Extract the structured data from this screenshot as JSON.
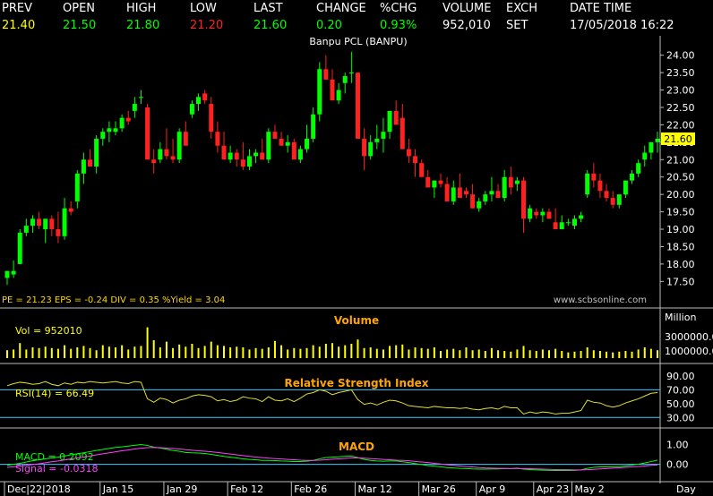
{
  "quote": {
    "headers": [
      "PREV",
      "OPEN",
      "HIGH",
      "LOW",
      "LAST",
      "CHANGE",
      "%CHG",
      "VOLUME",
      "EXCH",
      "DATE TIME"
    ],
    "values": [
      "21.40",
      "21.50",
      "21.80",
      "21.20",
      "21.60",
      "0.20",
      "0.93%",
      "952,010",
      "SET",
      "17/05/2018 16:22"
    ],
    "value_colors": [
      "#ffff00",
      "#00ff00",
      "#00ff00",
      "#ff2020",
      "#00ff00",
      "#00ff00",
      "#00ff00",
      "#ffffff",
      "#ffffff",
      "#ffffff"
    ]
  },
  "chart_data": [
    {
      "type": "candlestick",
      "title": "Banpu PCL (BANPU)",
      "fundamentals": "PE = 21.23   EPS = -0.24   DIV = 0.35   %Yield = 3.04",
      "watermark": "www.scbsonline.com",
      "last_label": "21.60",
      "ylim": [
        17.2,
        24.3
      ],
      "y_ticks": [
        "24.00",
        "23.50",
        "23.00",
        "22.50",
        "22.00",
        "21.50",
        "21.00",
        "20.50",
        "20.00",
        "19.50",
        "19.00",
        "18.50",
        "18.00",
        "17.50"
      ],
      "x_ticks": [
        "Dec|22|2018",
        "Jan|15",
        "Jan|29",
        "Feb|12",
        "Feb|26",
        "Mar|12",
        "Mar|26",
        "Apr|9",
        "Apr|23",
        "May|2",
        "Day"
      ],
      "x_tick_index": [
        0,
        15,
        25,
        35,
        45,
        55,
        65,
        74,
        83,
        89
      ],
      "colors": {
        "up": "#00ff00",
        "down": "#ff2020"
      },
      "ohlc": [
        [
          17.6,
          17.8,
          17.4,
          17.8
        ],
        [
          17.7,
          18.1,
          17.6,
          17.8
        ],
        [
          18.0,
          19.0,
          18.0,
          18.9
        ],
        [
          18.9,
          19.3,
          18.8,
          19.1
        ],
        [
          19.1,
          19.4,
          18.9,
          19.3
        ],
        [
          19.3,
          19.5,
          19.0,
          19.1
        ],
        [
          19.0,
          19.3,
          18.6,
          19.3
        ],
        [
          19.3,
          19.4,
          18.8,
          19.0
        ],
        [
          19.0,
          19.5,
          18.6,
          18.8
        ],
        [
          18.8,
          19.9,
          18.7,
          19.6
        ],
        [
          19.6,
          19.8,
          19.4,
          19.5
        ],
        [
          19.8,
          20.7,
          19.6,
          20.6
        ],
        [
          20.6,
          21.2,
          20.3,
          21.0
        ],
        [
          21.0,
          21.3,
          20.9,
          20.8
        ],
        [
          20.8,
          21.7,
          20.6,
          21.6
        ],
        [
          21.6,
          21.9,
          21.4,
          21.8
        ],
        [
          21.8,
          22.1,
          21.5,
          21.9
        ],
        [
          21.8,
          22.1,
          21.7,
          21.9
        ],
        [
          21.9,
          22.3,
          21.8,
          22.2
        ],
        [
          22.2,
          22.4,
          22.0,
          22.1
        ],
        [
          22.4,
          22.8,
          22.2,
          22.6
        ],
        [
          22.8,
          23.0,
          22.6,
          22.8
        ],
        [
          22.5,
          22.6,
          21.6,
          21.0
        ],
        [
          21.0,
          21.3,
          20.6,
          20.9
        ],
        [
          21.0,
          21.5,
          20.9,
          21.3
        ],
        [
          21.3,
          21.9,
          21.0,
          21.1
        ],
        [
          21.1,
          21.6,
          20.9,
          21.0
        ],
        [
          21.0,
          21.9,
          20.9,
          21.8
        ],
        [
          21.8,
          22.1,
          21.6,
          21.4
        ],
        [
          22.3,
          22.7,
          22.2,
          22.6
        ],
        [
          22.6,
          22.9,
          22.4,
          22.8
        ],
        [
          22.9,
          23.0,
          22.6,
          22.7
        ],
        [
          22.6,
          22.8,
          21.6,
          21.8
        ],
        [
          21.8,
          22.1,
          21.2,
          21.4
        ],
        [
          21.4,
          21.8,
          21.1,
          21.0
        ],
        [
          21.0,
          21.4,
          20.9,
          21.2
        ],
        [
          21.2,
          21.3,
          20.8,
          21.0
        ],
        [
          21.0,
          21.5,
          20.7,
          20.8
        ],
        [
          20.8,
          21.3,
          20.7,
          21.1
        ],
        [
          21.1,
          21.3,
          20.9,
          21.2
        ],
        [
          21.2,
          21.6,
          21.0,
          21.0
        ],
        [
          21.0,
          21.9,
          20.9,
          21.8
        ],
        [
          21.8,
          22.0,
          21.6,
          21.6
        ],
        [
          21.6,
          21.8,
          21.4,
          21.4
        ],
        [
          21.4,
          21.7,
          21.2,
          21.5
        ],
        [
          21.5,
          21.6,
          21.2,
          21.0
        ],
        [
          21.0,
          21.4,
          20.9,
          21.3
        ],
        [
          21.3,
          22.0,
          21.2,
          21.6
        ],
        [
          21.6,
          22.5,
          21.5,
          22.3
        ],
        [
          22.3,
          23.8,
          22.1,
          23.6
        ],
        [
          23.6,
          24.0,
          23.3,
          23.3
        ],
        [
          23.3,
          23.6,
          23.0,
          22.7
        ],
        [
          22.7,
          23.2,
          22.6,
          23.0
        ],
        [
          23.2,
          23.5,
          22.9,
          23.4
        ],
        [
          23.5,
          24.1,
          23.2,
          23.5
        ],
        [
          23.5,
          23.5,
          21.7,
          21.6
        ],
        [
          21.6,
          21.9,
          20.7,
          21.1
        ],
        [
          21.1,
          21.7,
          21.0,
          21.5
        ],
        [
          21.5,
          22.0,
          21.3,
          21.6
        ],
        [
          21.6,
          22.2,
          21.2,
          21.8
        ],
        [
          21.8,
          22.3,
          21.6,
          22.4
        ],
        [
          22.4,
          22.7,
          22.3,
          22.0
        ],
        [
          22.2,
          22.6,
          21.6,
          21.3
        ],
        [
          21.3,
          21.6,
          20.9,
          21.1
        ],
        [
          21.1,
          21.3,
          20.5,
          20.9
        ],
        [
          20.9,
          21.0,
          20.5,
          20.5
        ],
        [
          20.5,
          20.7,
          20.2,
          20.2
        ],
        [
          20.2,
          20.4,
          19.9,
          20.4
        ],
        [
          20.4,
          20.6,
          20.2,
          20.3
        ],
        [
          20.3,
          20.5,
          19.8,
          19.8
        ],
        [
          19.8,
          20.4,
          19.7,
          20.2
        ],
        [
          20.2,
          20.6,
          20.0,
          19.9
        ],
        [
          20.1,
          20.2,
          19.9,
          20.0
        ],
        [
          20.0,
          20.3,
          19.6,
          19.6
        ],
        [
          19.6,
          19.9,
          19.5,
          19.8
        ],
        [
          19.8,
          20.1,
          19.7,
          20.0
        ],
        [
          20.0,
          20.5,
          19.8,
          20.1
        ],
        [
          20.1,
          20.3,
          19.9,
          19.9
        ],
        [
          19.9,
          20.7,
          19.8,
          20.5
        ],
        [
          20.5,
          20.8,
          20.0,
          20.2
        ],
        [
          20.3,
          20.5,
          20.1,
          20.4
        ],
        [
          20.4,
          20.5,
          18.9,
          19.3
        ],
        [
          19.3,
          19.7,
          19.2,
          19.6
        ],
        [
          19.5,
          19.6,
          19.3,
          19.4
        ],
        [
          19.4,
          19.6,
          19.2,
          19.5
        ],
        [
          19.5,
          19.6,
          19.3,
          19.3
        ],
        [
          19.2,
          19.6,
          19.0,
          19.0
        ],
        [
          19.0,
          19.4,
          19.0,
          19.2
        ],
        [
          19.2,
          19.3,
          19.1,
          19.2
        ],
        [
          19.1,
          19.4,
          19.0,
          19.3
        ],
        [
          19.3,
          19.5,
          19.2,
          19.4
        ],
        [
          20.0,
          20.7,
          19.9,
          20.6
        ],
        [
          20.6,
          20.9,
          20.2,
          20.4
        ],
        [
          20.4,
          20.6,
          19.9,
          20.1
        ],
        [
          20.1,
          20.3,
          19.8,
          19.9
        ],
        [
          19.9,
          20.1,
          19.6,
          19.7
        ],
        [
          19.7,
          20.0,
          19.6,
          20.0
        ],
        [
          20.0,
          20.4,
          19.9,
          20.4
        ],
        [
          20.4,
          20.7,
          20.3,
          20.6
        ],
        [
          20.6,
          21.0,
          20.5,
          20.9
        ],
        [
          21.0,
          21.4,
          20.8,
          21.2
        ],
        [
          21.2,
          21.5,
          21.0,
          21.5
        ],
        [
          21.5,
          21.8,
          21.2,
          21.6
        ]
      ]
    },
    {
      "type": "bar",
      "title": "Volume",
      "label": "Vol  =  952010",
      "unit": "Million",
      "ylim": [
        0,
        6000000
      ],
      "y_ticks": [
        3000000,
        1000000
      ],
      "y_tick_labels": [
        "3000000.0",
        "1000000.0"
      ],
      "color": "#ffff00",
      "values": [
        1100000,
        1200000,
        2100000,
        1200000,
        1500000,
        1400000,
        1600000,
        1400000,
        1300000,
        1800000,
        1300000,
        1500000,
        1700000,
        1400000,
        1100000,
        1800000,
        1600000,
        1500000,
        1800000,
        1200000,
        1600000,
        1700000,
        4300000,
        2500000,
        1500000,
        2300000,
        1400000,
        1900000,
        1600000,
        2000000,
        1400000,
        1700000,
        2300000,
        1800000,
        1700000,
        1500000,
        1600000,
        1500000,
        1200000,
        1400000,
        1300000,
        1500000,
        2400000,
        1800000,
        1200000,
        1400000,
        1300000,
        1400000,
        1800000,
        1600000,
        2000000,
        2100000,
        1600000,
        1800000,
        2000000,
        2600000,
        1400000,
        1500000,
        1300000,
        1200000,
        1700000,
        1800000,
        1900000,
        1200000,
        1500000,
        1400000,
        1300000,
        1500000,
        1000000,
        1200000,
        1300000,
        1100000,
        1500000,
        1100000,
        1200000,
        1000000,
        1400000,
        1100000,
        1000000,
        900000,
        1200000,
        1700000,
        1100000,
        1000000,
        1200000,
        1100000,
        1300000,
        1000000,
        800000,
        900000,
        1000000,
        1500000,
        1100000,
        1000000,
        900000,
        800000,
        900000,
        1000000,
        900000,
        1200000,
        1500000,
        1300000,
        1100000
      ]
    },
    {
      "type": "line",
      "title": "Relative Strength Index",
      "label": "RSI(14)  =  66.49",
      "ylim": [
        20,
        90
      ],
      "y_ticks": [
        90,
        70,
        50,
        30
      ],
      "y_tick_labels": [
        "90.00",
        "70.00",
        "50.00",
        "30.00"
      ],
      "ref_lines": [
        70,
        30
      ],
      "color": "#e0e030",
      "values": [
        76,
        79,
        81,
        80,
        78,
        79,
        82,
        78,
        76,
        80,
        78,
        81,
        80,
        82,
        81,
        80,
        81,
        82,
        80,
        79,
        82,
        81,
        57,
        52,
        58,
        56,
        51,
        55,
        57,
        61,
        63,
        62,
        60,
        54,
        56,
        53,
        55,
        60,
        58,
        57,
        53,
        60,
        55,
        54,
        57,
        53,
        58,
        64,
        66,
        70,
        68,
        63,
        66,
        68,
        70,
        56,
        49,
        51,
        48,
        52,
        55,
        54,
        51,
        47,
        46,
        45,
        44,
        46,
        45,
        44,
        44,
        43,
        44,
        42,
        41,
        43,
        44,
        42,
        46,
        44,
        44,
        35,
        38,
        36,
        38,
        37,
        35,
        36,
        36,
        38,
        40,
        55,
        52,
        51,
        47,
        45,
        47,
        51,
        54,
        57,
        61,
        65,
        66
      ]
    },
    {
      "type": "line",
      "title": "MACD",
      "ylim": [
        -0.6,
        1.2
      ],
      "y_ticks": [
        1.0,
        0.0
      ],
      "y_tick_labels": [
        "1.00",
        "0.00"
      ],
      "series": [
        {
          "name": "MACD  =  0.2092",
          "color": "#00ff00",
          "values": [
            -0.05,
            0.0,
            0.05,
            0.12,
            0.18,
            0.23,
            0.28,
            0.33,
            0.36,
            0.42,
            0.48,
            0.53,
            0.58,
            0.64,
            0.7,
            0.75,
            0.8,
            0.85,
            0.88,
            0.92,
            0.96,
            1.0,
            0.95,
            0.87,
            0.82,
            0.76,
            0.7,
            0.66,
            0.6,
            0.58,
            0.57,
            0.55,
            0.5,
            0.45,
            0.4,
            0.36,
            0.32,
            0.28,
            0.25,
            0.23,
            0.2,
            0.2,
            0.19,
            0.17,
            0.16,
            0.14,
            0.14,
            0.16,
            0.2,
            0.28,
            0.34,
            0.36,
            0.38,
            0.4,
            0.42,
            0.34,
            0.25,
            0.2,
            0.17,
            0.16,
            0.17,
            0.17,
            0.13,
            0.09,
            0.04,
            -0.01,
            -0.06,
            -0.09,
            -0.12,
            -0.16,
            -0.18,
            -0.2,
            -0.21,
            -0.23,
            -0.24,
            -0.24,
            -0.23,
            -0.23,
            -0.21,
            -0.21,
            -0.19,
            -0.24,
            -0.26,
            -0.28,
            -0.29,
            -0.3,
            -0.31,
            -0.31,
            -0.31,
            -0.3,
            -0.28,
            -0.2,
            -0.15,
            -0.13,
            -0.13,
            -0.12,
            -0.11,
            -0.08,
            -0.04,
            0.01,
            0.07,
            0.14,
            0.21
          ]
        },
        {
          "name": "Signal  =  -0.0318",
          "color": "#ff40ff",
          "values": [
            -0.15,
            -0.12,
            -0.09,
            -0.05,
            -0.01,
            0.03,
            0.08,
            0.13,
            0.17,
            0.22,
            0.27,
            0.32,
            0.37,
            0.42,
            0.48,
            0.53,
            0.58,
            0.63,
            0.68,
            0.72,
            0.77,
            0.81,
            0.84,
            0.85,
            0.84,
            0.82,
            0.8,
            0.77,
            0.74,
            0.71,
            0.68,
            0.66,
            0.63,
            0.6,
            0.56,
            0.52,
            0.48,
            0.44,
            0.4,
            0.37,
            0.34,
            0.31,
            0.29,
            0.27,
            0.25,
            0.23,
            0.21,
            0.2,
            0.2,
            0.21,
            0.23,
            0.26,
            0.28,
            0.3,
            0.32,
            0.32,
            0.31,
            0.29,
            0.27,
            0.25,
            0.23,
            0.21,
            0.2,
            0.18,
            0.15,
            0.12,
            0.09,
            0.05,
            0.02,
            -0.02,
            -0.05,
            -0.08,
            -0.11,
            -0.13,
            -0.16,
            -0.18,
            -0.19,
            -0.2,
            -0.2,
            -0.21,
            -0.21,
            -0.21,
            -0.22,
            -0.23,
            -0.24,
            -0.25,
            -0.26,
            -0.27,
            -0.27,
            -0.28,
            -0.28,
            -0.27,
            -0.25,
            -0.23,
            -0.21,
            -0.19,
            -0.17,
            -0.15,
            -0.13,
            -0.11,
            -0.08,
            -0.05,
            -0.03
          ]
        }
      ]
    }
  ]
}
